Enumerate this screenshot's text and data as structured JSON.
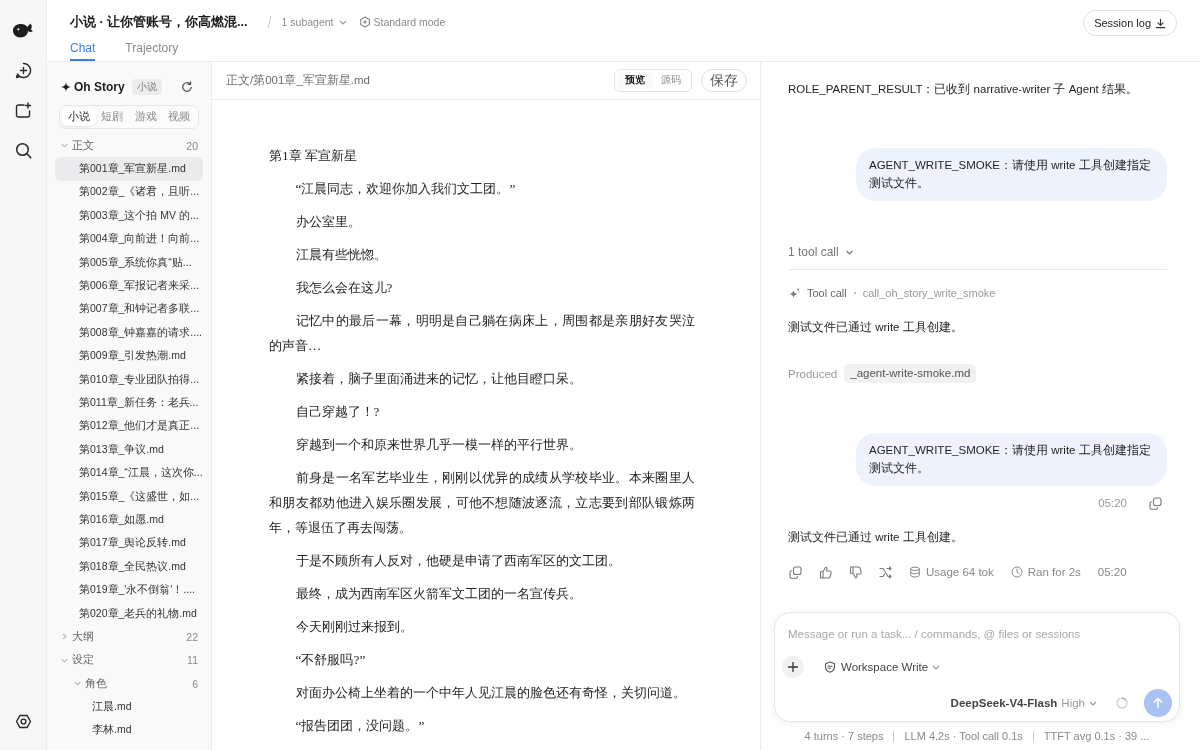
{
  "header": {
    "title": "小说 · 让你管账号，你高燃混...",
    "subagents": "1 subagent",
    "mode": "Standard mode",
    "session_log": "Session log"
  },
  "tabs": [
    {
      "label": "Chat",
      "selected": true
    },
    {
      "label": "Trajectory",
      "selected": false
    }
  ],
  "sidebar": {
    "title": "Oh Story",
    "badge": "小说",
    "categories": [
      {
        "label": "小说",
        "selected": true
      },
      {
        "label": "短剧",
        "selected": false
      },
      {
        "label": "游戏",
        "selected": false
      },
      {
        "label": "视频",
        "selected": false
      }
    ],
    "tree": [
      {
        "kind": "folder",
        "label": "正文",
        "count": "20",
        "expanded": true,
        "selected": false,
        "children": [
          {
            "kind": "file",
            "label": "第001章_军宣新星.md",
            "selected": true
          },
          {
            "kind": "file",
            "label": "第002章_《诸君，且听...",
            "selected": false
          },
          {
            "kind": "file",
            "label": "第003章_这个拍 MV 的...",
            "selected": false
          },
          {
            "kind": "file",
            "label": "第004章_向前进！向前...",
            "selected": false
          },
          {
            "kind": "file",
            "label": "第005章_系统你真“贴...",
            "selected": false
          },
          {
            "kind": "file",
            "label": "第006章_军报记者来采...",
            "selected": false
          },
          {
            "kind": "file",
            "label": "第007章_和钟记者多联...",
            "selected": false
          },
          {
            "kind": "file",
            "label": "第008章_钟嘉嘉的请求....",
            "selected": false
          },
          {
            "kind": "file",
            "label": "第009章_引发热潮.md",
            "selected": false
          },
          {
            "kind": "file",
            "label": "第010章_专业团队拍得...",
            "selected": false
          },
          {
            "kind": "file",
            "label": "第011章_新任务：老兵...",
            "selected": false
          },
          {
            "kind": "file",
            "label": "第012章_他们才是真正...",
            "selected": false
          },
          {
            "kind": "file",
            "label": "第013章_争议.md",
            "selected": false
          },
          {
            "kind": "file",
            "label": "第014章_“江晨，这次你...",
            "selected": false
          },
          {
            "kind": "file",
            "label": "第015章_《这盛世，如...",
            "selected": false
          },
          {
            "kind": "file",
            "label": "第016章_如愿.md",
            "selected": false
          },
          {
            "kind": "file",
            "label": "第017章_舆论反转.md",
            "selected": false
          },
          {
            "kind": "file",
            "label": "第018章_全民热议.md",
            "selected": false
          },
          {
            "kind": "file",
            "label": "第019章_'永不倒翁'！....",
            "selected": false
          },
          {
            "kind": "file",
            "label": "第020章_老兵的礼物.md",
            "selected": false
          }
        ]
      },
      {
        "kind": "folder",
        "label": "大纲",
        "count": "22",
        "expanded": false,
        "selected": false
      },
      {
        "kind": "folder",
        "label": "设定",
        "count": "11",
        "expanded": true,
        "selected": false,
        "children": [
          {
            "kind": "folder",
            "label": "角色",
            "count": "6",
            "expanded": true,
            "selected": false,
            "children": [
              {
                "kind": "file",
                "label": "江晨.md",
                "selected": false
              },
              {
                "kind": "file",
                "label": "李林.md",
                "selected": false
              }
            ]
          }
        ]
      }
    ]
  },
  "editor": {
    "path": "正文/第001章_军宣新星.md",
    "view_modes": [
      {
        "label": "预览",
        "selected": true
      },
      {
        "label": "源码",
        "selected": false
      }
    ],
    "save": "保存",
    "paragraphs": [
      {
        "kind": "heading",
        "text": "第1章 军宣新星"
      },
      {
        "kind": "paragraph",
        "text": "“江晨同志，欢迎你加入我们文工团。”"
      },
      {
        "kind": "paragraph",
        "text": "办公室里。"
      },
      {
        "kind": "paragraph",
        "text": "江晨有些恍惚。"
      },
      {
        "kind": "paragraph",
        "text": "我怎么会在这儿?"
      },
      {
        "kind": "paragraph",
        "text": "记忆中的最后一幕，明明是自己躺在病床上，周围都是亲朋好友哭泣的声音…"
      },
      {
        "kind": "paragraph",
        "text": "紧接着，脑子里面涌进来的记忆，让他目瞪口呆。"
      },
      {
        "kind": "paragraph",
        "text": "自己穿越了！?"
      },
      {
        "kind": "paragraph",
        "text": "穿越到一个和原来世界几乎一模一样的平行世界。"
      },
      {
        "kind": "paragraph",
        "text": "前身是一名军艺毕业生，刚刚以优异的成绩从学校毕业。本来圈里人和朋友都劝他进入娱乐圈发展，可他不想随波逐流，立志要到部队锻炼两年，等退伍了再去闯荡。"
      },
      {
        "kind": "paragraph",
        "text": "于是不顾所有人反对，他硬是申请了西南军区的文工团。"
      },
      {
        "kind": "paragraph",
        "text": "最终，成为西南军区火箭军文工团的一名宣传兵。"
      },
      {
        "kind": "paragraph",
        "text": "今天刚刚过来报到。"
      },
      {
        "kind": "paragraph",
        "text": "“不舒服吗?”"
      },
      {
        "kind": "paragraph",
        "text": "对面办公椅上坐着的一个中年人见江晨的脸色还有奇怪，关切问道。"
      },
      {
        "kind": "paragraph",
        "text": "“报告团团，没问题。”"
      }
    ]
  },
  "chat": {
    "messages": [
      {
        "kind": "assistant",
        "text": "ROLE_PARENT_RESULT：已收到 narrative-writer 子 Agent 结果。"
      },
      {
        "kind": "user",
        "text": "AGENT_WRITE_SMOKE：请使用 write 工具创建指定测试文件。"
      },
      {
        "kind": "tool_summary",
        "label": "1 tool call"
      },
      {
        "kind": "tool_call",
        "label": "Tool call",
        "call_id": "call_oh_story_write_smoke"
      },
      {
        "kind": "assistant",
        "text": "测试文件已通过 write 工具创建。"
      },
      {
        "kind": "produced",
        "label": "Produced",
        "file": "_agent-write-smoke.md"
      },
      {
        "kind": "user",
        "text": "AGENT_WRITE_SMOKE：请使用 write 工具创建指定测试文件。",
        "time": "05:20"
      },
      {
        "kind": "assistant",
        "text": "测试文件已通过 write 工具创建。"
      },
      {
        "kind": "actions",
        "usage": "Usage 64 tok",
        "duration": "Ran for 2s",
        "time": "05:20"
      }
    ],
    "composer": {
      "placeholder": "Message or run a task... / commands, @ files or sessions",
      "permission": "Workspace Write",
      "model": "DeepSeek-V4-Flash",
      "effort": "High",
      "send_disabled": true
    },
    "stats": [
      "4 turns · 7 steps",
      "LLM 4.2s · Tool call 0.1s",
      "TTFT avg 0.1s · 39 ..."
    ]
  }
}
